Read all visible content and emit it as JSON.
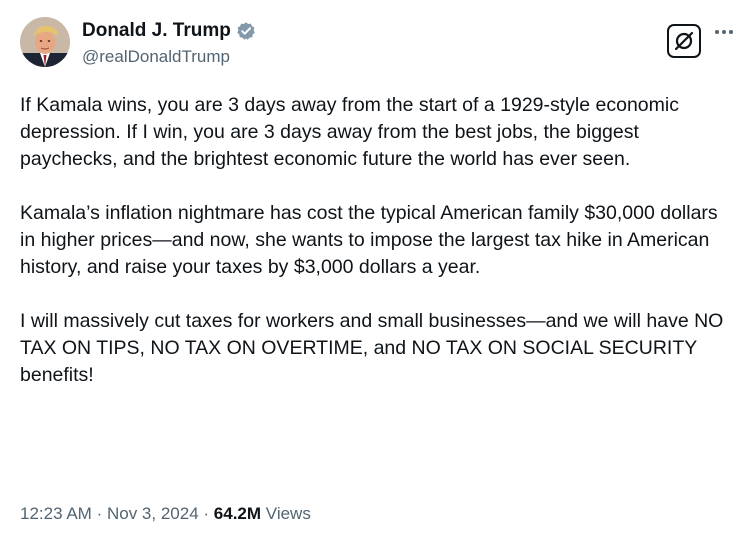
{
  "author": {
    "display_name": "Donald J. Trump",
    "handle": "@realDonaldTrump",
    "verified_badge_icon": "verified-badge-icon",
    "badge_color": "#829aab"
  },
  "actions": {
    "grok_icon": "grok-icon",
    "more_icon": "more-icon"
  },
  "tweet": {
    "paragraphs": [
      "If Kamala wins, you are 3 days away from the start of a 1929-style economic depression. If I win, you are 3 days away from the best jobs, the biggest paychecks, and the brightest economic future the world has ever seen.",
      "Kamala’s inflation nightmare has cost the typical American family $30,000 dollars in higher prices—and now, she wants to impose the largest tax hike in American history, and raise your taxes by $3,000 dollars a year.",
      "I will massively cut taxes for workers and small businesses—and we will have NO TAX ON TIPS, NO TAX ON OVERTIME, and NO TAX ON SOCIAL SECURITY benefits!"
    ]
  },
  "meta": {
    "time": "12:23 AM",
    "separator": "·",
    "date": "Nov 3, 2024",
    "views_count": "64.2M",
    "views_label": "Views"
  },
  "colors": {
    "text_primary": "#0f1419",
    "text_secondary": "#536471"
  }
}
